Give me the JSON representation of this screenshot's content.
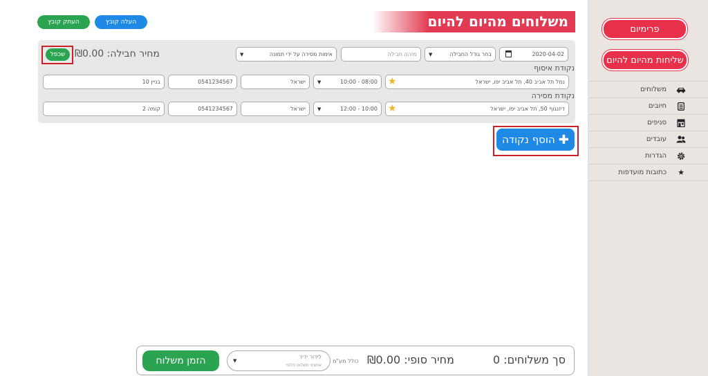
{
  "sidebar": {
    "primary_button": "פרימיום",
    "secondary_button": "שליחות מהיום להיום",
    "items": [
      {
        "label": "משלוחים",
        "icon": "car-icon"
      },
      {
        "label": "חיובים",
        "icon": "invoice-icon"
      },
      {
        "label": "סניפים",
        "icon": "store-icon"
      },
      {
        "label": "עובדים",
        "icon": "users-icon"
      },
      {
        "label": "הגדרות",
        "icon": "gear-icon"
      },
      {
        "label": "כתובות מועדפות",
        "icon": "star-icon"
      }
    ]
  },
  "header": {
    "title": "משלוחים מהיום להיום",
    "upload_label": "העלה קובץ",
    "copy_file_label": "העתק קובץ"
  },
  "shipment": {
    "date": "2020-04-02",
    "package_size": "בחר גודל החבילה",
    "package_id_placeholder": "מזהה חבילה",
    "delivery_verification": "אימות מסירה על ידי תמונה",
    "package_price": "מחיר חבילה: ₪0.00",
    "duplicate_label": "שכפל",
    "pickup": {
      "label": "נקודת איסוף",
      "address": "נמל תל אביב 40, תל אביב יפו, ישראל",
      "time": "10:00 - 08:00",
      "country": "ישראל",
      "phone": "0541234567",
      "details": "בניין 10"
    },
    "dropoff": {
      "label": "נקודת מסירה",
      "address": "דיזנגוף 50, תל אביב יפו, ישראל",
      "time": "12:00 - 10:00",
      "country": "ישראל",
      "phone": "0541234567",
      "details": "קומה 2"
    }
  },
  "add_point_label": "הוסף נקודה",
  "footer": {
    "shipments_count": "סך משלוחים: 0",
    "final_price": "מחיר סופי: ₪0.00",
    "vat_note": "כולל מע\"מ",
    "delivery_option": "לידור ידיד",
    "delivery_sub": "אמצעי תשלום חלופי",
    "order_button": "הזמן משלוח"
  },
  "colors": {
    "accent_red": "#e23a52",
    "blue": "#1f8ae6",
    "green": "#2ba452",
    "sidebar_bg": "#ebe5e1",
    "highlight_border": "#cc2027"
  }
}
